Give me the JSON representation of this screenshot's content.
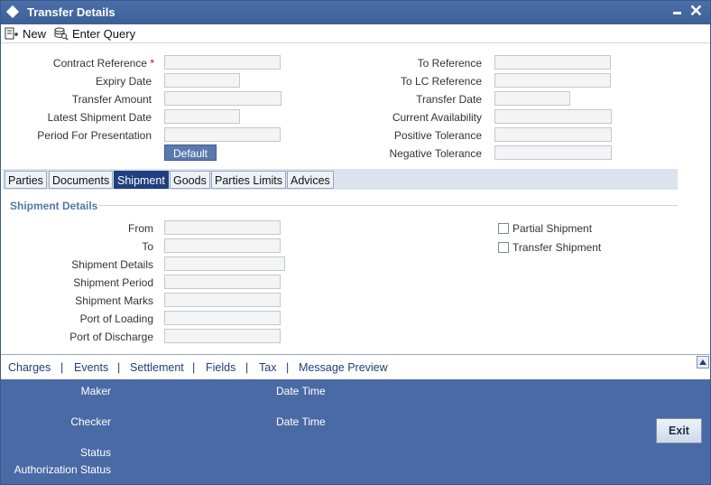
{
  "window": {
    "title": "Transfer Details"
  },
  "toolbar": {
    "new_label": "New",
    "enter_query_label": "Enter Query"
  },
  "header_fields": {
    "contract_reference": {
      "label": "Contract Reference",
      "required": "*",
      "value": ""
    },
    "expiry_date": {
      "label": "Expiry Date",
      "value": ""
    },
    "transfer_amount": {
      "label": "Transfer Amount",
      "value": ""
    },
    "latest_shipment_date": {
      "label": "Latest Shipment Date",
      "value": ""
    },
    "period_for_presentation": {
      "label": "Period For Presentation",
      "value": ""
    },
    "default_button": "Default",
    "to_reference": {
      "label": "To Reference",
      "value": ""
    },
    "to_lc_reference": {
      "label": "To LC Reference",
      "value": ""
    },
    "transfer_date": {
      "label": "Transfer Date",
      "value": ""
    },
    "current_availability": {
      "label": "Current Availability",
      "value": ""
    },
    "positive_tolerance": {
      "label": "Positive Tolerance",
      "value": ""
    },
    "negative_tolerance": {
      "label": "Negative Tolerance",
      "value": ""
    }
  },
  "tabs": [
    {
      "label": "Parties"
    },
    {
      "label": "Documents"
    },
    {
      "label": "Shipment",
      "active": true
    },
    {
      "label": "Goods"
    },
    {
      "label": "Parties Limits"
    },
    {
      "label": "Advices"
    }
  ],
  "shipment": {
    "section_title": "Shipment Details",
    "from": {
      "label": "From",
      "value": ""
    },
    "to": {
      "label": "To",
      "value": ""
    },
    "shipment_details": {
      "label": "Shipment Details",
      "value": ""
    },
    "shipment_period": {
      "label": "Shipment Period",
      "value": ""
    },
    "shipment_marks": {
      "label": "Shipment Marks",
      "value": ""
    },
    "port_of_loading": {
      "label": "Port of Loading",
      "value": ""
    },
    "port_of_discharge": {
      "label": "Port of Discharge",
      "value": ""
    },
    "partial_shipment": {
      "label": "Partial Shipment",
      "checked": false
    },
    "transfer_shipment": {
      "label": "Transfer Shipment",
      "checked": false
    }
  },
  "links": [
    "Charges",
    "Events",
    "Settlement",
    "Fields",
    "Tax",
    "Message Preview"
  ],
  "link_separator": "|",
  "footer": {
    "maker": "Maker",
    "maker_date_time": "Date Time",
    "checker": "Checker",
    "checker_date_time": "Date Time",
    "status": "Status",
    "authorization_status": "Authorization Status",
    "exit_button": "Exit"
  },
  "colors": {
    "titlebar": "#3d5f97",
    "active_tab": "#203f7e",
    "footer": "#4a6aa5",
    "required": "#cc0000"
  },
  "icons": {
    "window": "diamond-icon",
    "minimize": "minimize-icon",
    "close": "close-icon",
    "new": "new-document-icon",
    "enter_query": "query-icon"
  }
}
